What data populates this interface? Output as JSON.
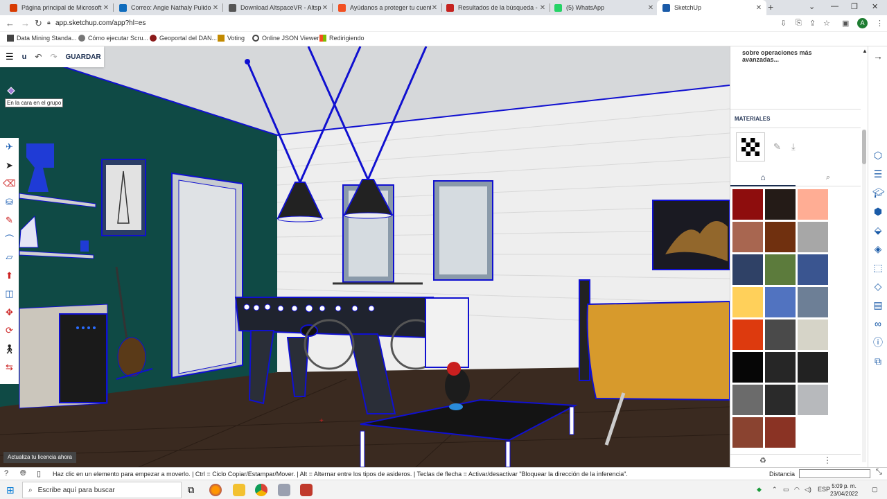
{
  "browser": {
    "tabs": [
      {
        "title": "Página principal de Microsoft Of...",
        "favicon_color": "#d83b01",
        "active": false
      },
      {
        "title": "Correo: Angie Nathaly Pulido Ca...",
        "favicon_color": "#0f6cbd",
        "active": false
      },
      {
        "title": "Download AltspaceVR - Altspac...",
        "favicon_color": "#555555",
        "active": false
      },
      {
        "title": "Ayúdanos a proteger tu cuenta",
        "favicon_color": "#f25022",
        "active": false
      },
      {
        "title": "Resultados de la búsqueda - u f...",
        "favicon_color": "#c5221f",
        "active": false
      },
      {
        "title": "(5) WhatsApp",
        "favicon_color": "#25d366",
        "active": false
      },
      {
        "title": "SketchUp",
        "favicon_color": "#1a5ba8",
        "active": true
      }
    ],
    "new_tab": "+",
    "url": "app.sketchup.com/app?hl=es",
    "avatar_letter": "A",
    "bookmarks": [
      {
        "label": "Data Mining Standa...",
        "color": "#444444"
      },
      {
        "label": "Cómo ejecutar Scru...",
        "color": "#666666"
      },
      {
        "label": "Geoportal del DAN...",
        "color": "#8b1a1a"
      },
      {
        "label": "Voting",
        "color": "#c28a00"
      },
      {
        "label": "Online JSON Viewer",
        "color": "#444444"
      },
      {
        "label": "Redirigiendo",
        "color": "#d83b01"
      }
    ]
  },
  "app": {
    "toolbar": {
      "menu_icon": "hamburger-icon",
      "undo_icon": "undo-icon",
      "redo_icon": "redo-icon",
      "save_label": "GUARDAR",
      "u_label": "u"
    },
    "tooltip": "En la cara en el grupo",
    "license_button": "Actualiza tu licencia ahora",
    "left_tools": [
      "select-icon",
      "eraser-icon",
      "paint-bucket-icon",
      "pencil-icon",
      "arc-icon",
      "rectangle-icon",
      "push-pull-icon",
      "offset-icon",
      "move-icon",
      "rotate-icon",
      "walk-icon",
      "tape-icon"
    ],
    "right_panel": {
      "tip_text": "sobre operaciones más avanzadas...",
      "materials_title": "MATERIALES",
      "swatches": [
        "#8e0d0d",
        "#241b17",
        "#ffad94",
        "#a86650",
        "#70300f",
        "#a7a7a7",
        "#2f4166",
        "#5c7b3c",
        "#3a5590",
        "#ffd05a",
        "#5173c0",
        "#6d7f96",
        "#dd3a0e",
        "#4a4a4a",
        "#d6d4c8",
        "#060606",
        "#262626",
        "#222222",
        "#6b6b6b",
        "#2a2a2a",
        "#b7b9bc",
        "#8a4330",
        "#8a3324",
        "#ffffff"
      ]
    },
    "right_rail_icons": [
      "entity-info-icon",
      "outliner-icon",
      "instructor-icon",
      "components-icon",
      "styles-icon",
      "materials-icon",
      "tags-icon",
      "scenes-icon",
      "display-icon",
      "info-icon",
      "solid-inspector-icon"
    ],
    "status": {
      "message": "Haz clic en un elemento para empezar a moverlo. | Ctrl = Ciclo Copiar/Estampar/Mover. | Alt = Alternar entre los tipos de asideros. | Teclas de flecha = Activar/desactivar \"Bloquear la dirección de la inferencia\".",
      "measurement_label": "Distancia",
      "measurement_value": ""
    }
  },
  "taskbar": {
    "search_placeholder": "Escribe aquí para buscar",
    "language": "ESP",
    "time": "5:09 p. m.",
    "date": "23/04/2022"
  }
}
